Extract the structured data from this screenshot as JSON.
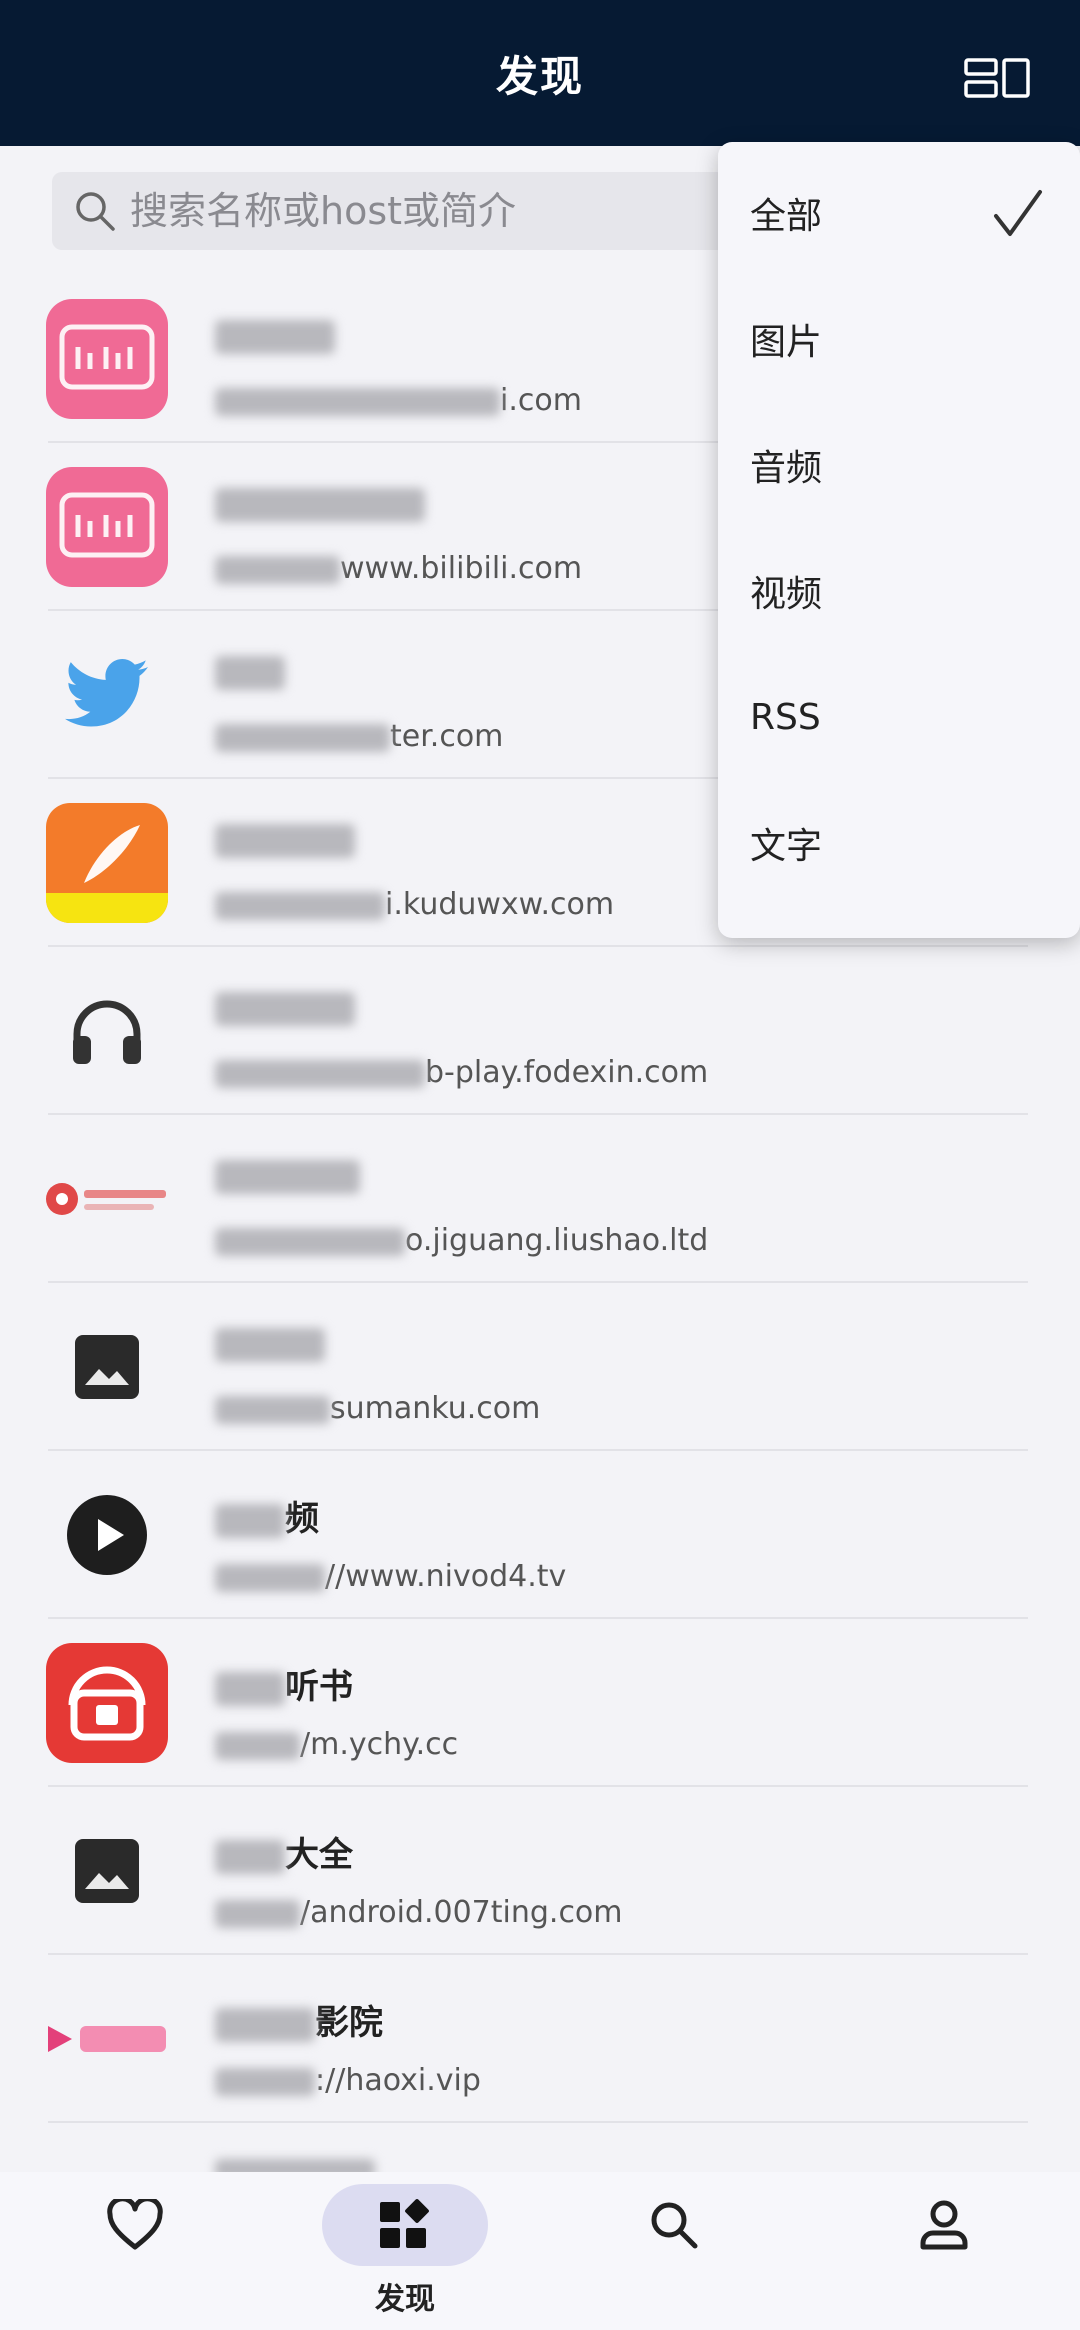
{
  "header": {
    "title": "发现",
    "layout_icon": "grid-layout-icon"
  },
  "search": {
    "placeholder": "搜索名称或host或简介"
  },
  "sources": [
    {
      "name_visible": "",
      "host_visible": "i.com",
      "icon": "bilibili-logo"
    },
    {
      "name_visible": "",
      "host_visible": "www.bilibili.com",
      "icon": "bilibili-logo"
    },
    {
      "name_visible": "",
      "host_visible": "ter.com",
      "icon": "twitter-bird"
    },
    {
      "name_visible": "",
      "host_visible": "i.kuduwxw.com",
      "icon": "quill-app"
    },
    {
      "name_visible": "",
      "host_visible": "b-play.fodexin.com",
      "icon": "headphones-icon"
    },
    {
      "name_visible": "",
      "host_visible": "o.jiguang.liushao.ltd",
      "icon": "red-logo"
    },
    {
      "name_visible": "",
      "host_visible": "sumanku.com",
      "icon": "image-icon"
    },
    {
      "name_visible": "频",
      "host_visible": "//www.nivod4.tv",
      "icon": "play-icon"
    },
    {
      "name_visible": "听书",
      "host_visible": "/m.ychy.cc",
      "icon": "radio-app"
    },
    {
      "name_visible": "大全",
      "host_visible": "/android.007ting.com",
      "icon": "image-icon"
    },
    {
      "name_visible": "影院",
      "host_visible": "://haoxi.vip",
      "icon": "pink-logo"
    }
  ],
  "filter_menu": {
    "options": [
      "全部",
      "图片",
      "音频",
      "视频",
      "RSS",
      "文字"
    ],
    "selected_index": 0
  },
  "bottom_nav": {
    "items": [
      {
        "label": "",
        "icon": "heart-icon"
      },
      {
        "label": "发现",
        "icon": "discover-icon",
        "active": true
      },
      {
        "label": "",
        "icon": "search-icon"
      },
      {
        "label": "",
        "icon": "user-icon"
      }
    ]
  },
  "colors": {
    "header_bg": "#061a33",
    "accent_pill": "#dcdcf1",
    "bilibili_pink": "#f06a95"
  }
}
